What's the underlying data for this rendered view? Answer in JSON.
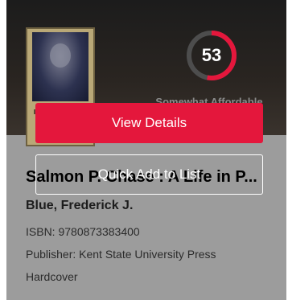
{
  "product": {
    "title": "Salmon P. Chase : A Life in P...",
    "author": "Blue, Frederick J.",
    "isbn": "ISBN: 9780873383400",
    "publisher": "Publisher: Kent State University Press",
    "format": "Hardcover"
  },
  "score": {
    "value": "53",
    "fraction": 0.53,
    "label": "Somewhat Affordable",
    "accent": "#e4173c",
    "track": "#4d4d4d"
  },
  "actions": {
    "view_details": "View Details",
    "quick_add": "Quick Add to List"
  }
}
